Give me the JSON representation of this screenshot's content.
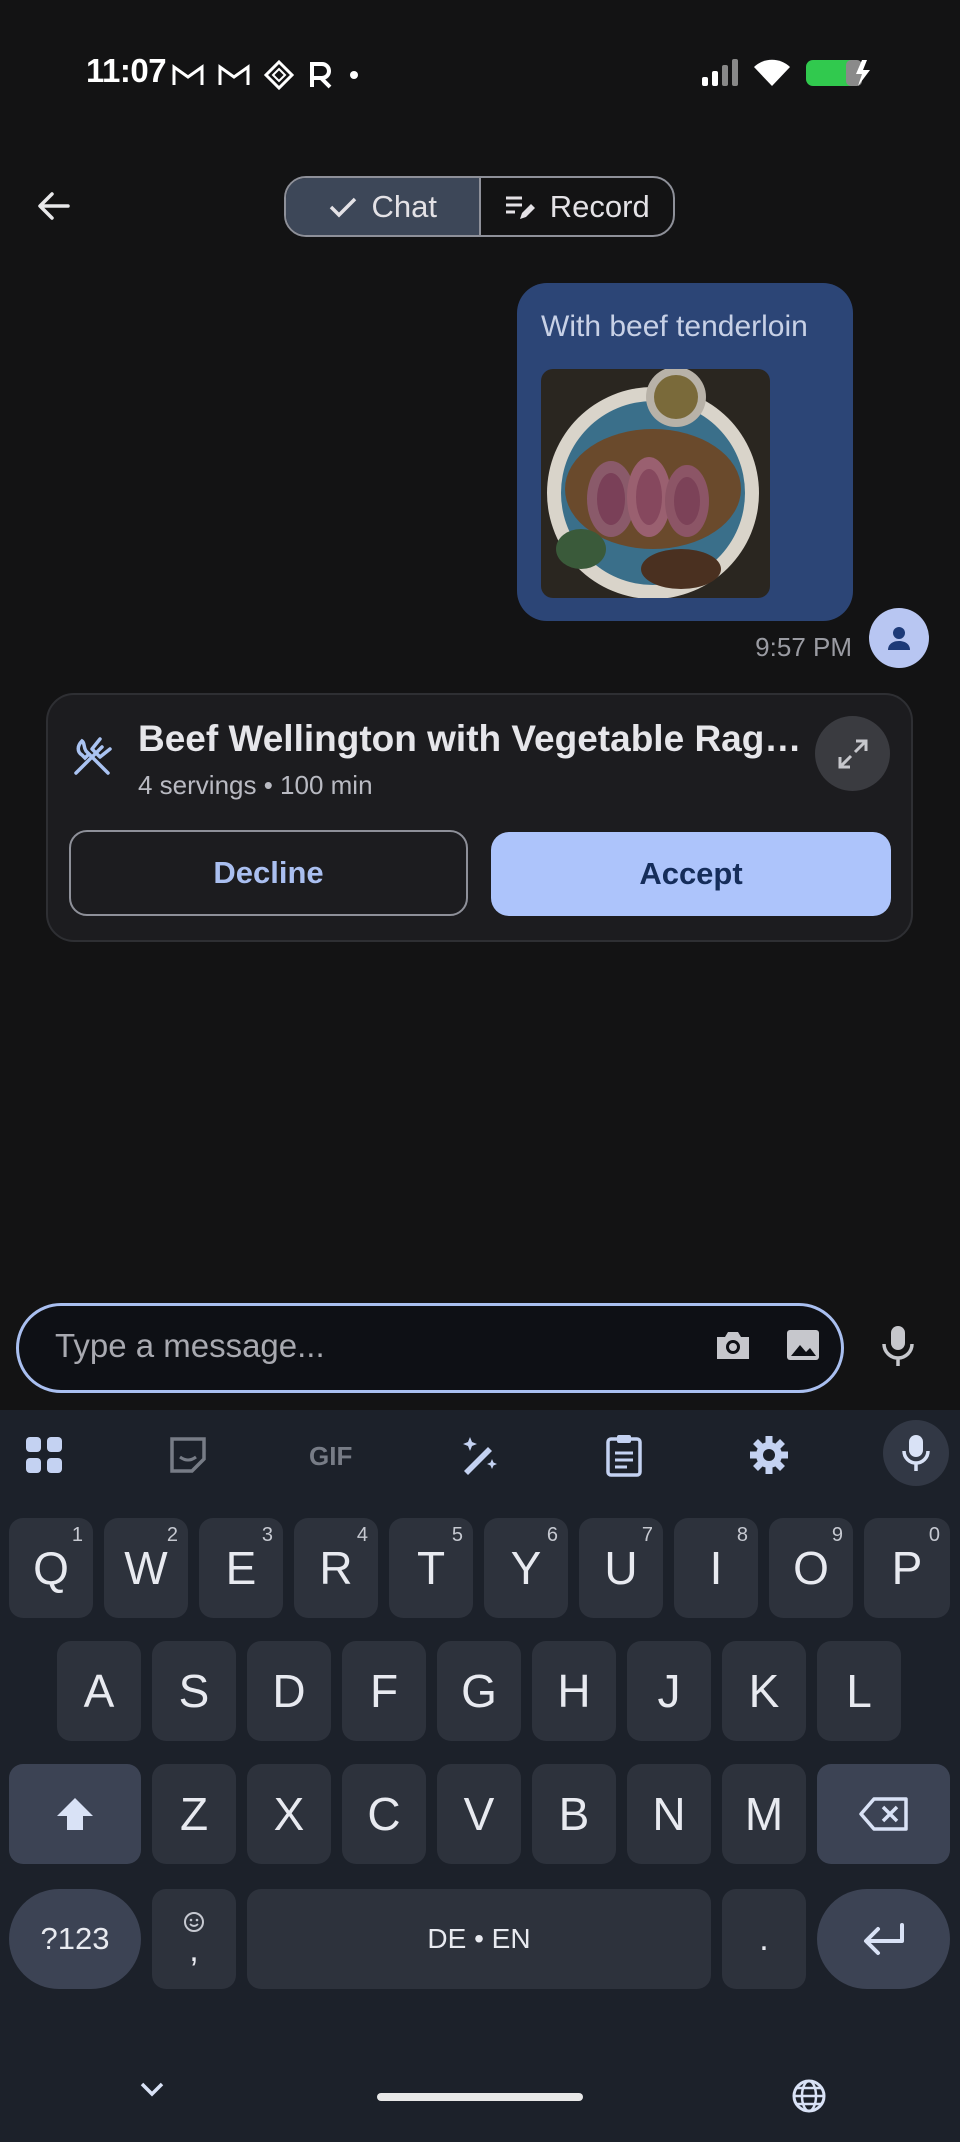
{
  "status_bar": {
    "time": "11:07",
    "left_icons": [
      "gmail-icon",
      "gmail-icon",
      "app-diamond-icon",
      "r-app-icon",
      "dot-icon"
    ],
    "right_icons": [
      "signal-icon",
      "wifi-icon",
      "battery-charging-icon"
    ]
  },
  "top_bar": {
    "tabs": [
      {
        "label": "Chat",
        "icon": "check-icon",
        "selected": true
      },
      {
        "label": "Record",
        "icon": "edit-list-icon",
        "selected": false
      }
    ]
  },
  "message": {
    "text": "With beef tenderloin",
    "image_description_icon": "food-photo",
    "time": "9:57 PM"
  },
  "recipe_card": {
    "title": "Beef Wellington with Vegetable Rago...",
    "meta": "4 servings • 100 min",
    "decline_label": "Decline",
    "accept_label": "Accept"
  },
  "composer": {
    "placeholder": "Type a message..."
  },
  "keyboard": {
    "row1": [
      {
        "k": "Q",
        "s": "1"
      },
      {
        "k": "W",
        "s": "2"
      },
      {
        "k": "E",
        "s": "3"
      },
      {
        "k": "R",
        "s": "4"
      },
      {
        "k": "T",
        "s": "5"
      },
      {
        "k": "Y",
        "s": "6"
      },
      {
        "k": "U",
        "s": "7"
      },
      {
        "k": "I",
        "s": "8"
      },
      {
        "k": "O",
        "s": "9"
      },
      {
        "k": "P",
        "s": "0"
      }
    ],
    "row2": [
      "A",
      "S",
      "D",
      "F",
      "G",
      "H",
      "J",
      "K",
      "L"
    ],
    "row3": [
      "Z",
      "X",
      "C",
      "V",
      "B",
      "N",
      "M"
    ],
    "symbols_label": "?123",
    "emoji_comma": ",",
    "space_label": "DE • EN",
    "period": ".",
    "colors": {
      "accent": "#adc4fb",
      "bubble": "#2c4576"
    }
  }
}
